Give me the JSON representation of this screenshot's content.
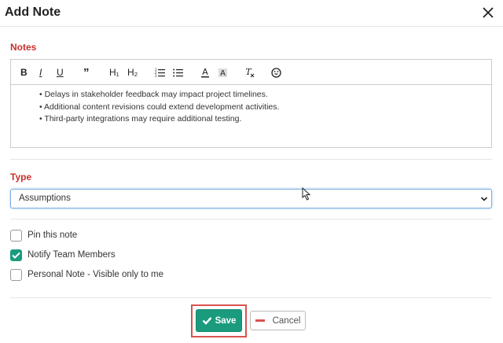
{
  "dialog": {
    "title": "Add Note"
  },
  "notes": {
    "label": "Notes",
    "toolbar": {
      "bold": "B",
      "italic": "I",
      "underline": "U",
      "blockquote": "”",
      "h1": "H₁",
      "h2": "H₂"
    },
    "bullets": [
      "Delays in stakeholder feedback may impact project timelines.",
      "Additional content revisions could extend development activities.",
      "Third-party integrations may require additional testing."
    ]
  },
  "type": {
    "label": "Type",
    "selected": "Assumptions"
  },
  "options": [
    {
      "label": "Pin this note",
      "checked": false
    },
    {
      "label": "Notify Team Members",
      "checked": true
    },
    {
      "label": "Personal Note - Visible only to me",
      "checked": false
    }
  ],
  "actions": {
    "save_label": "Save",
    "cancel_label": "Cancel"
  },
  "colors": {
    "accent": "#1a9b7e",
    "label_red": "#c9302c",
    "highlight": "#d9534f"
  }
}
